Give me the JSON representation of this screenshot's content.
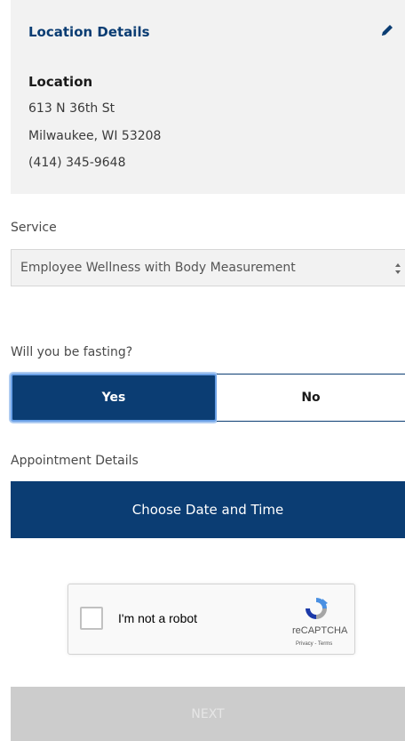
{
  "location_details": {
    "heading": "Location Details",
    "location_label": "Location",
    "address_line1": "613 N 36th St",
    "address_line2": "Milwaukee, WI 53208",
    "phone": "(414) 345-9648"
  },
  "service": {
    "label": "Service",
    "selected": "Employee Wellness with Body Measurement"
  },
  "fasting": {
    "label": "Will you be fasting?",
    "yes_label": "Yes",
    "no_label": "No",
    "selected": "Yes"
  },
  "appointment": {
    "label": "Appointment Details",
    "button_label": "Choose Date and Time"
  },
  "recaptcha": {
    "checkbox_label": "I'm not a robot",
    "brand": "reCAPTCHA",
    "links": "Privacy - Terms"
  },
  "next": {
    "label": "NEXT"
  },
  "colors": {
    "primary": "#0b3d73",
    "card_bg": "#f2f2f2",
    "disabled_bg": "#cccccc",
    "focus_ring": "#6aa0e6"
  }
}
